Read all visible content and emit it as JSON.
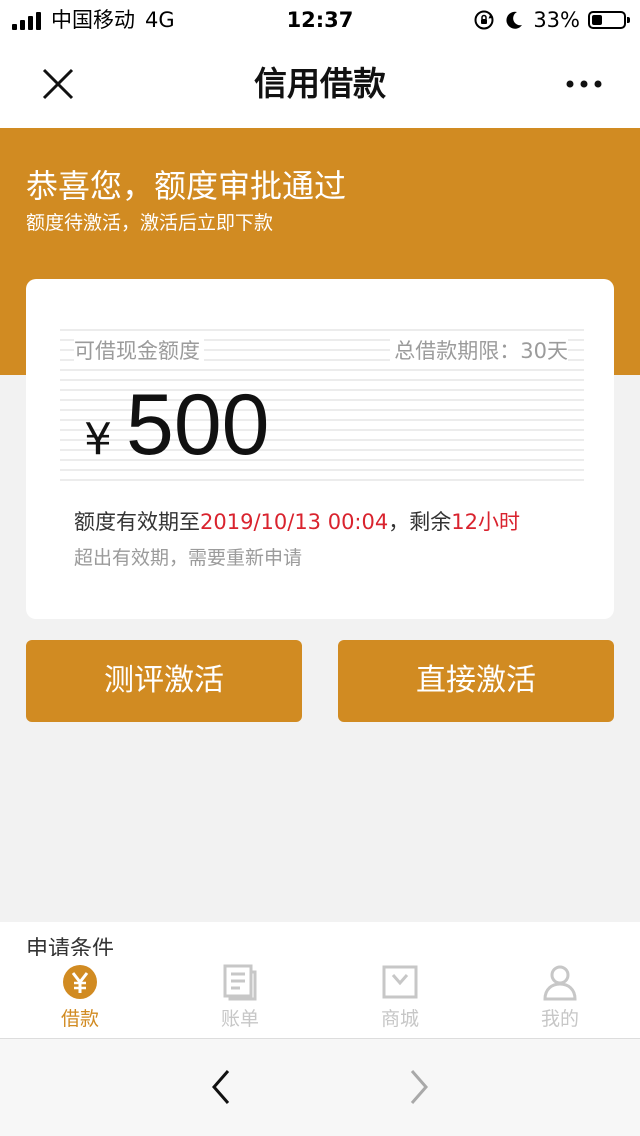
{
  "status_bar": {
    "carrier": "中国移动",
    "network": "4G",
    "time": "12:37",
    "battery_percent": "33%",
    "battery_level": 0.33
  },
  "nav": {
    "title": "信用借款",
    "close_icon": "close-icon",
    "more_icon": "more-dots-icon"
  },
  "banner": {
    "title": "恭喜您，额度审批通过",
    "subtitle": "额度待激活，激活后立即下款",
    "color": "#d18b22"
  },
  "card": {
    "limit_label": "可借现金额度",
    "term": "总借款期限：30天",
    "currency": "¥",
    "amount": "500",
    "validity_prefix": "额度有效期至",
    "validity_date": "2019/10/13 00:04",
    "validity_mid": "，剩余",
    "remaining": "12小时",
    "note": "超出有效期，需要重新申请",
    "highlight_color": "#d9232e"
  },
  "buttons": {
    "evaluate": "测评激活",
    "direct": "直接激活"
  },
  "apply_conditions": "申请条件",
  "tabs": [
    {
      "label": "借款",
      "icon": "yuan-coin-icon",
      "active": true
    },
    {
      "label": "账单",
      "icon": "bill-icon",
      "active": false
    },
    {
      "label": "商城",
      "icon": "shopping-bag-icon",
      "active": false
    },
    {
      "label": "我的",
      "icon": "user-icon",
      "active": false
    }
  ],
  "browser": {
    "back_icon": "back-arrow-icon",
    "forward_icon": "forward-arrow-icon"
  }
}
